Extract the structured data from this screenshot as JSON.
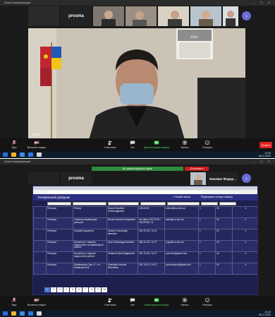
{
  "top": {
    "title": "Zoom Конференция",
    "strip_name": "prosma",
    "main_caption": "Zoom",
    "toolbar": [
      {
        "label": "Звук",
        "icon": "microphone-icon"
      },
      {
        "label": "Включить видео",
        "icon": "camera-icon"
      },
      {
        "label": "Участники",
        "icon": "participants-icon"
      },
      {
        "label": "Чат",
        "icon": "chat-icon"
      },
      {
        "label": "Демонстрация экрана",
        "icon": "share-screen-icon"
      },
      {
        "label": "Запись",
        "icon": "record-icon"
      },
      {
        "label": "Реакции",
        "icon": "reactions-icon"
      }
    ],
    "end_label": "Выйти",
    "clock_time": "14:40",
    "clock_date": "08.11.2020"
  },
  "bottom": {
    "title": "Zoom Конференция",
    "strip_name": "prosma",
    "strip_name_2": "Начекко Федор...",
    "share_banner": "Вы демонстрируете экран",
    "share_stop": "Остановить",
    "app": {
      "title": "Телефонный довідник",
      "action_new": "+ Новий запис",
      "action_status": "Редагувати статус запису",
      "rows": [
        [
          "Ректорат",
          "Ректор",
          "Васюк Михайло Олександрович",
          "226-69-60",
          "rektor@nuu.edu.ua",
          "1",
          "30"
        ],
        [
          "Ректорат",
          "Секретар керівництва ректорат",
          "Вольга Наталія Федорівна",
          "тел-факс 226-79-30 / 226-69-85 / 11",
          "adm@nuu.edu.ua",
          "1",
          "30"
        ],
        [
          "Ректорат",
          "Перший проректор",
          "Калкан Олександр Іванович",
          "226-79-25 / 14-01",
          "",
          "1",
          "31"
        ],
        [
          "Ректорат",
          "Проректор з науково-педагогічної та гуманітарної роботи",
          "Гуза Олександр Іванович",
          "068-13-49 / 14-77",
          "p.gu@nuu.edu.ua",
          "1",
          "40"
        ],
        [
          "Ректорат",
          "Проректор з науково-педагогічної роботи",
          "Новиков Юрій Вадимович",
          "226-75-05 / 14-07",
          "yurrector@gmail.com",
          "1",
          "42"
        ],
        [
          "Ректорат",
          "Приймальня Серг О.І. та Новикова Ю.В.",
          "Рукенова Наталія Віталіївна",
          "226-75-10 / 14-07",
          "yourreceptor@gmail.com",
          "1",
          "43"
        ]
      ],
      "pages": [
        "1",
        "2",
        "3",
        "4",
        "5",
        "6",
        "7",
        "8",
        "9",
        "10"
      ],
      "active_page": "1"
    },
    "toolbar": [
      {
        "label": "Звук",
        "icon": "microphone-icon"
      },
      {
        "label": "Включить видео",
        "icon": "camera-icon"
      },
      {
        "label": "Участники",
        "icon": "participants-icon"
      },
      {
        "label": "Чат",
        "icon": "chat-icon"
      },
      {
        "label": "Новая демонстрация",
        "icon": "share-screen-icon"
      },
      {
        "label": "Запись",
        "icon": "record-icon"
      },
      {
        "label": "Реакции",
        "icon": "reactions-icon"
      }
    ],
    "clock_time": "14:42",
    "clock_date": "08.11.2020"
  }
}
